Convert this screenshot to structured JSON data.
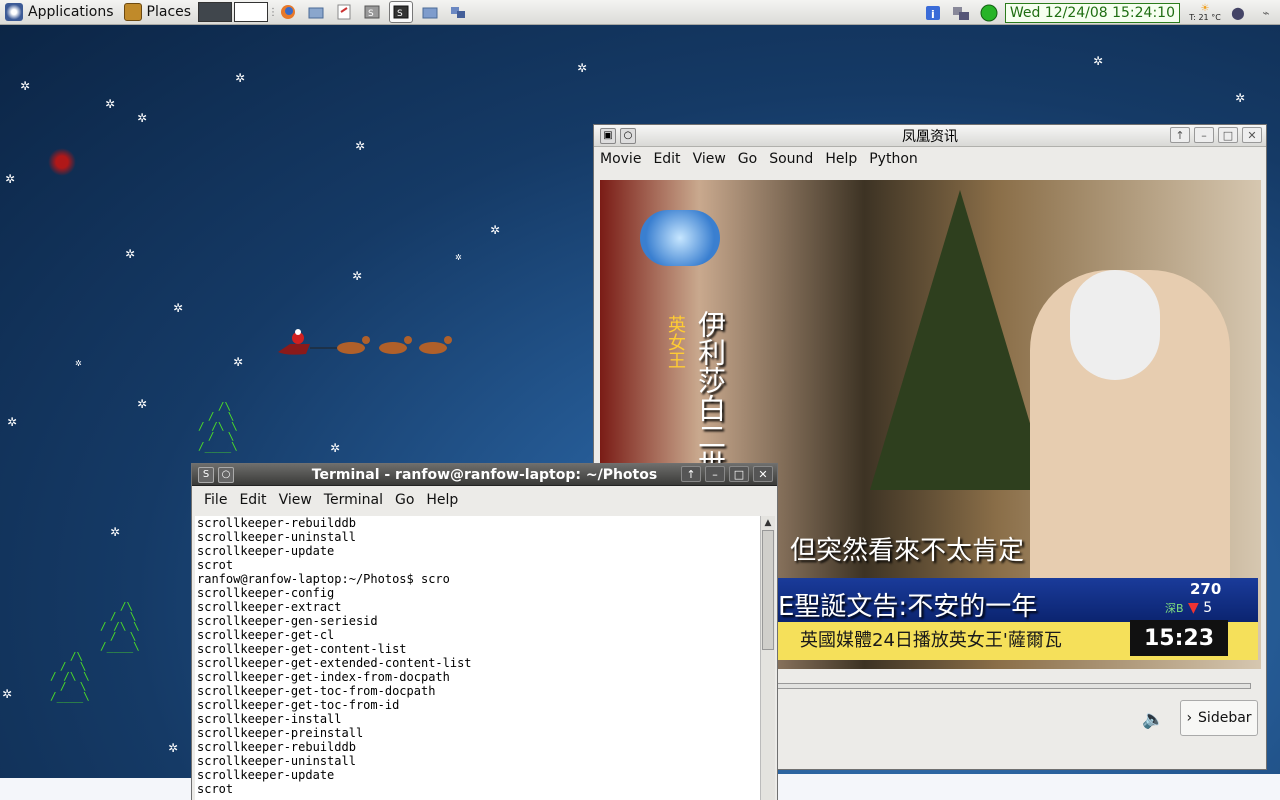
{
  "panel": {
    "applications": "Applications",
    "places": "Places",
    "launchers": [
      "firefox-icon",
      "files-icon",
      "gedit-icon",
      "terminal-icon",
      "terminal-icon",
      "folder-icon",
      "network-icon"
    ],
    "clock": "Wed 12/24/08 15:24:10",
    "weather": "T: 21 °C"
  },
  "player": {
    "title": "凤凰资讯",
    "menu": [
      "Movie",
      "Edit",
      "View",
      "Go",
      "Sound",
      "Help",
      "Python"
    ],
    "captions": {
      "vertical_white": "伊利莎白二世",
      "vertical_yellow": "英女王",
      "subtitle": "但突然看來不太肯定",
      "headline": "E聖誕文告:不安的一年",
      "ticker": "英國媒體24日播放英女王'薩爾瓦",
      "time": "15:23",
      "stat_top": "270",
      "stat_bottom": "5",
      "stat_label": "深B"
    },
    "sidebar_button": "Sidebar"
  },
  "terminal": {
    "title": "Terminal - ranfow@ranfow-laptop: ~/Photos",
    "menu": [
      "File",
      "Edit",
      "View",
      "Terminal",
      "Go",
      "Help"
    ],
    "lines": [
      "scrollkeeper-rebuilddb",
      "scrollkeeper-uninstall",
      "scrollkeeper-update",
      "scrot",
      "ranfow@ranfow-laptop:~/Photos$ scro",
      "scrollkeeper-config",
      "scrollkeeper-extract",
      "scrollkeeper-gen-seriesid",
      "scrollkeeper-get-cl",
      "scrollkeeper-get-content-list",
      "scrollkeeper-get-extended-content-list",
      "scrollkeeper-get-index-from-docpath",
      "scrollkeeper-get-toc-from-docpath",
      "scrollkeeper-get-toc-from-id",
      "scrollkeeper-install",
      "scrollkeeper-preinstall",
      "scrollkeeper-rebuilddb",
      "scrollkeeper-uninstall",
      "scrollkeeper-update",
      "scrot"
    ]
  },
  "colors": {
    "panel_clock": "#1f6e12",
    "desktop": "#255a94"
  }
}
